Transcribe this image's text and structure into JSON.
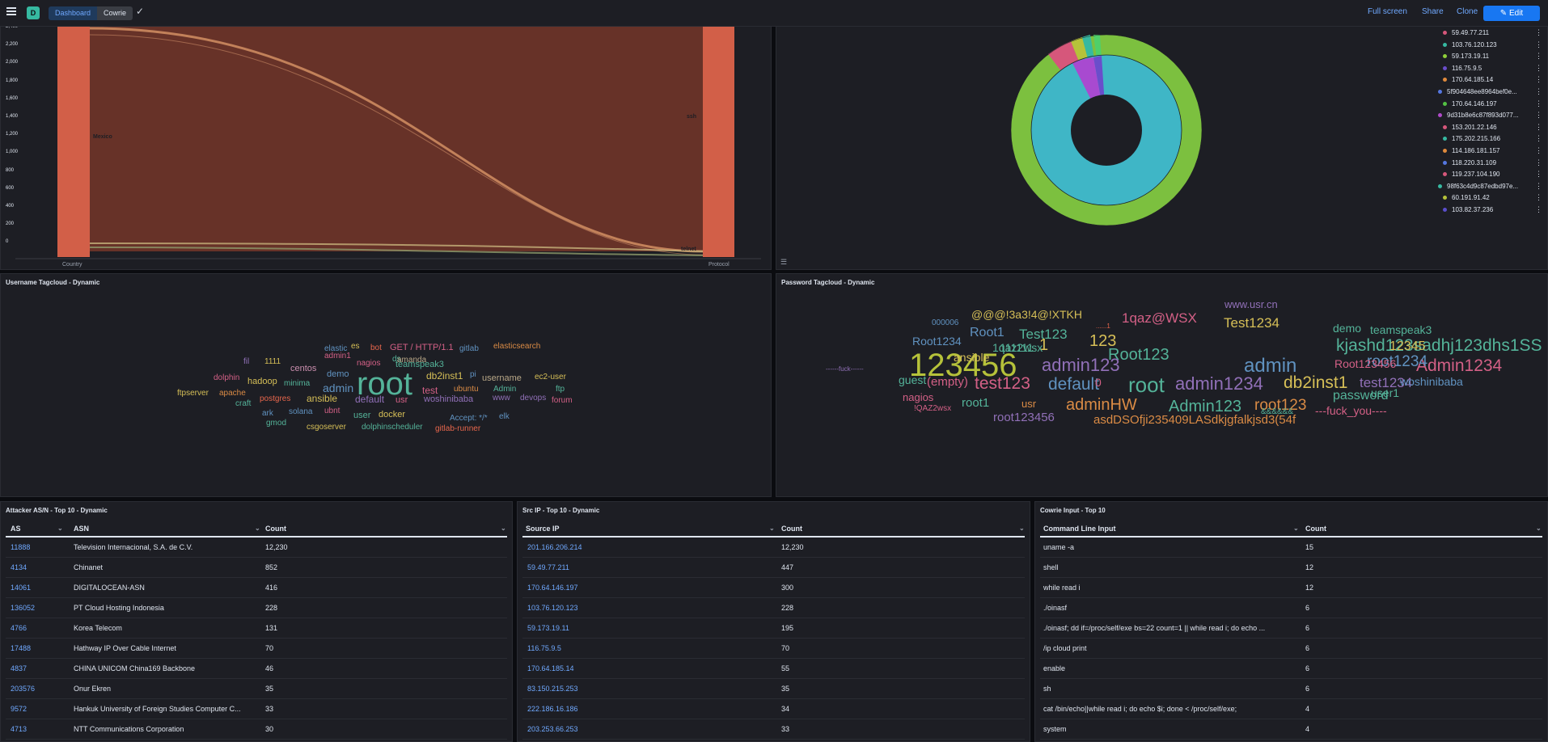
{
  "topbar": {
    "logo_letter": "D",
    "breadcrumb_dashboard": "Dashboard",
    "breadcrumb_current": "Cowrie",
    "check": "✓",
    "full_screen": "Full screen",
    "share": "Share",
    "clone": "Clone",
    "edit": "Edit"
  },
  "sankey": {
    "yticks": [
      "2,400",
      "2,200",
      "2,000",
      "1,800",
      "1,600",
      "1,400",
      "1,200",
      "1,000",
      "800",
      "600",
      "400",
      "200",
      "0"
    ],
    "left_node": "Mexico",
    "right_node_top": "ssh",
    "right_node_bottom": "telnet",
    "xlabel_left": "Country",
    "xlabel_right": "Protocol"
  },
  "donut": {
    "legend": [
      {
        "label": "59.49.77.211",
        "color": "#d6577b"
      },
      {
        "label": "103.76.120.123",
        "color": "#36b9a1"
      },
      {
        "label": "59.173.19.11",
        "color": "#8fcf3a"
      },
      {
        "label": "116.75.9.5",
        "color": "#6a4ecb"
      },
      {
        "label": "170.64.185.14",
        "color": "#e08a3c"
      },
      {
        "label": "5f904648ee8964bef0e...",
        "color": "#5577e0"
      },
      {
        "label": "170.64.146.197",
        "color": "#54c244"
      },
      {
        "label": "9d31b8e6c87f893d077...",
        "color": "#b04ac9"
      },
      {
        "label": "153.201.22.146",
        "color": "#d6577b"
      },
      {
        "label": "175.202.215.166",
        "color": "#36b9a1"
      },
      {
        "label": "114.186.181.157",
        "color": "#e08a3c"
      },
      {
        "label": "118.220.31.109",
        "color": "#5577e0"
      },
      {
        "label": "119.237.104.190",
        "color": "#d6577b"
      },
      {
        "label": "98f63c4d9c87edbd97e...",
        "color": "#36b9a1"
      },
      {
        "label": "60.191.91.42",
        "color": "#b6c23a"
      },
      {
        "label": "103.82.37.236",
        "color": "#5a4ecb"
      }
    ]
  },
  "username_cloud": {
    "title": "Username Tagcloud - Dynamic",
    "words": [
      {
        "t": "root",
        "s": 40,
        "c": "#54b399"
      },
      {
        "t": "GET / HTTP/1.1",
        "s": 11,
        "c": "#d36086"
      },
      {
        "t": "gitlab",
        "s": 10,
        "c": "#6092c0"
      },
      {
        "t": "elasticsearch",
        "s": 10,
        "c": "#da8b45"
      },
      {
        "t": "es",
        "s": 10,
        "c": "#d6bf57"
      },
      {
        "t": "bot",
        "s": 10,
        "c": "#e7664c"
      },
      {
        "t": "elastic",
        "s": 10,
        "c": "#6092c0"
      },
      {
        "t": "admin1",
        "s": 10,
        "c": "#d36086"
      },
      {
        "t": "ds",
        "s": 10,
        "c": "#54b399"
      },
      {
        "t": "nagios",
        "s": 10,
        "c": "#d36086"
      },
      {
        "t": "teamspeak3",
        "s": 11,
        "c": "#54b399"
      },
      {
        "t": "amanda",
        "s": 10,
        "c": "#b9a888"
      },
      {
        "t": "fil",
        "s": 10,
        "c": "#9170b8"
      },
      {
        "t": "1111",
        "s": 10,
        "c": "#d6bf57"
      },
      {
        "t": "centos",
        "s": 11,
        "c": "#ca8eae"
      },
      {
        "t": "demo",
        "s": 11,
        "c": "#6092c0"
      },
      {
        "t": "db2inst1",
        "s": 12,
        "c": "#d6bf57"
      },
      {
        "t": "pi",
        "s": 10,
        "c": "#6092c0"
      },
      {
        "t": "username",
        "s": 11,
        "c": "#b9a888"
      },
      {
        "t": "ec2-user",
        "s": 10,
        "c": "#d6bf57"
      },
      {
        "t": "dolphin",
        "s": 10,
        "c": "#d36086"
      },
      {
        "t": "hadoop",
        "s": 11,
        "c": "#d6bf57"
      },
      {
        "t": "minima",
        "s": 10,
        "c": "#54b399"
      },
      {
        "t": "admin",
        "s": 14,
        "c": "#6092c0"
      },
      {
        "t": "test",
        "s": 12,
        "c": "#d36086"
      },
      {
        "t": "ubuntu",
        "s": 10,
        "c": "#da8b45"
      },
      {
        "t": "Admin",
        "s": 10,
        "c": "#54b399"
      },
      {
        "t": "ftp",
        "s": 10,
        "c": "#54b399"
      },
      {
        "t": "ftpserver",
        "s": 10,
        "c": "#d6bf57"
      },
      {
        "t": "apache",
        "s": 10,
        "c": "#da8b45"
      },
      {
        "t": "craft",
        "s": 10,
        "c": "#54b399"
      },
      {
        "t": "postgres",
        "s": 10,
        "c": "#e7664c"
      },
      {
        "t": "ansible",
        "s": 12,
        "c": "#d6bf57"
      },
      {
        "t": "default",
        "s": 12,
        "c": "#9170b8"
      },
      {
        "t": "usr",
        "s": 11,
        "c": "#d36086"
      },
      {
        "t": "woshinibaba",
        "s": 11,
        "c": "#9170b8"
      },
      {
        "t": "www",
        "s": 10,
        "c": "#9170b8"
      },
      {
        "t": "devops",
        "s": 10,
        "c": "#9170b8"
      },
      {
        "t": "forum",
        "s": 10,
        "c": "#d36086"
      },
      {
        "t": "ark",
        "s": 10,
        "c": "#6092c0"
      },
      {
        "t": "solana",
        "s": 10,
        "c": "#6092c0"
      },
      {
        "t": "ubnt",
        "s": 10,
        "c": "#d36086"
      },
      {
        "t": "user",
        "s": 11,
        "c": "#54b399"
      },
      {
        "t": "docker",
        "s": 11,
        "c": "#d6bf57"
      },
      {
        "t": "Accept: */*",
        "s": 10,
        "c": "#6092c0"
      },
      {
        "t": "elk",
        "s": 10,
        "c": "#6092c0"
      },
      {
        "t": "gmod",
        "s": 10,
        "c": "#54b399"
      },
      {
        "t": "csgoserver",
        "s": 10,
        "c": "#d6bf57"
      },
      {
        "t": "dolphinscheduler",
        "s": 10,
        "c": "#54b399"
      },
      {
        "t": "gitlab-runner",
        "s": 10,
        "c": "#e7664c"
      }
    ]
  },
  "password_cloud": {
    "title": "Password Tagcloud - Dynamic",
    "words": [
      {
        "t": "www.usr.cn",
        "s": 13,
        "c": "#9170b8"
      },
      {
        "t": "@@@!3a3!4@!XTKH",
        "s": 14,
        "c": "#d6bf57"
      },
      {
        "t": "1qaz@WSX",
        "s": 17,
        "c": "#d36086"
      },
      {
        "t": "Test1234",
        "s": 17,
        "c": "#d6bf57"
      },
      {
        "t": "000006",
        "s": 10,
        "c": "#6092c0"
      },
      {
        "t": "......1",
        "s": 8,
        "c": "#e7664c"
      },
      {
        "t": "demo",
        "s": 14,
        "c": "#54b399"
      },
      {
        "t": "teamspeak3",
        "s": 14,
        "c": "#54b399"
      },
      {
        "t": "Root1",
        "s": 16,
        "c": "#6092c0"
      },
      {
        "t": "Test123",
        "s": 17,
        "c": "#54b399"
      },
      {
        "t": "Root1234",
        "s": 14,
        "c": "#6092c0"
      },
      {
        "t": "1",
        "s": 20,
        "c": "#d6bf57"
      },
      {
        "t": "123",
        "s": 20,
        "c": "#d6bf57"
      },
      {
        "t": "kjashd123sadhj123dhs1SS",
        "s": 21,
        "c": "#54b399"
      },
      {
        "t": "12345",
        "s": 16,
        "c": "#d6bf57"
      },
      {
        "t": "1qaz2wsx",
        "s": 14,
        "c": "#54b399"
      },
      {
        "t": "111111",
        "s": 14,
        "c": "#54b399"
      },
      {
        "t": "Root123",
        "s": 20,
        "c": "#54b399"
      },
      {
        "t": "123456",
        "s": 40,
        "c": "#b6c23a"
      },
      {
        "t": "ansible",
        "s": 14,
        "c": "#d6bf57"
      },
      {
        "t": "admin123",
        "s": 22,
        "c": "#9170b8"
      },
      {
        "t": "admin",
        "s": 24,
        "c": "#6092c0"
      },
      {
        "t": "Admin1234",
        "s": 21,
        "c": "#d36086"
      },
      {
        "t": "root1234",
        "s": 19,
        "c": "#6092c0"
      },
      {
        "t": "Root123456",
        "s": 14,
        "c": "#d36086"
      },
      {
        "t": "------fuck------",
        "s": 8,
        "c": "#9170b8"
      },
      {
        "t": "guest",
        "s": 14,
        "c": "#54b399"
      },
      {
        "t": "(empty)",
        "s": 15,
        "c": "#d36086"
      },
      {
        "t": "test123",
        "s": 21,
        "c": "#d36086"
      },
      {
        "t": "default",
        "s": 21,
        "c": "#6092c0"
      },
      {
        "t": "0",
        "s": 14,
        "c": "#d36086"
      },
      {
        "t": "root",
        "s": 26,
        "c": "#54b399"
      },
      {
        "t": "admin1234",
        "s": 22,
        "c": "#9170b8"
      },
      {
        "t": "db2inst1",
        "s": 21,
        "c": "#d6bf57"
      },
      {
        "t": "test1234",
        "s": 17,
        "c": "#9170b8"
      },
      {
        "t": "woshinibaba",
        "s": 14,
        "c": "#6092c0"
      },
      {
        "t": "nagios",
        "s": 13,
        "c": "#d36086"
      },
      {
        "t": "password",
        "s": 16,
        "c": "#54b399"
      },
      {
        "t": "user1",
        "s": 14,
        "c": "#54b399"
      },
      {
        "t": "root1",
        "s": 15,
        "c": "#54b399"
      },
      {
        "t": "usr",
        "s": 13,
        "c": "#da8b45"
      },
      {
        "t": "adminHW",
        "s": 20,
        "c": "#da8b45"
      },
      {
        "t": "Admin123",
        "s": 20,
        "c": "#54b399"
      },
      {
        "t": "root123",
        "s": 19,
        "c": "#da8b45"
      },
      {
        "t": "!QAZ2wsx",
        "s": 10,
        "c": "#d36086"
      },
      {
        "t": "&&&&&&",
        "s": 10,
        "c": "#54b399"
      },
      {
        "t": "---fuck_you----",
        "s": 14,
        "c": "#d36086"
      },
      {
        "t": "root123456",
        "s": 15,
        "c": "#9170b8"
      },
      {
        "t": "asdDSOfji235409LASdkjgfalkjsd3(54f",
        "s": 15,
        "c": "#da8b45"
      }
    ]
  },
  "asn_table": {
    "title": "Attacker AS/N - Top 10 - Dynamic",
    "headers": [
      "AS",
      "ASN",
      "Count"
    ],
    "rows": [
      [
        "11888",
        "Television Internacional, S.A. de C.V.",
        "12,230"
      ],
      [
        "4134",
        "Chinanet",
        "852"
      ],
      [
        "14061",
        "DIGITALOCEAN-ASN",
        "416"
      ],
      [
        "136052",
        "PT Cloud Hosting Indonesia",
        "228"
      ],
      [
        "4766",
        "Korea Telecom",
        "131"
      ],
      [
        "17488",
        "Hathway IP Over Cable Internet",
        "70"
      ],
      [
        "4837",
        "CHINA UNICOM China169 Backbone",
        "46"
      ],
      [
        "203576",
        "Onur Ekren",
        "35"
      ],
      [
        "9572",
        "Hankuk University of Foreign Studies Computer C...",
        "33"
      ],
      [
        "4713",
        "NTT Communications Corporation",
        "30"
      ]
    ]
  },
  "srcip_table": {
    "title": "Src IP - Top 10 - Dynamic",
    "headers": [
      "Source IP",
      "Count"
    ],
    "rows": [
      [
        "201.166.206.214",
        "12,230"
      ],
      [
        "59.49.77.211",
        "447"
      ],
      [
        "170.64.146.197",
        "300"
      ],
      [
        "103.76.120.123",
        "228"
      ],
      [
        "59.173.19.11",
        "195"
      ],
      [
        "116.75.9.5",
        "70"
      ],
      [
        "170.64.185.14",
        "55"
      ],
      [
        "83.150.215.253",
        "35"
      ],
      [
        "222.186.16.186",
        "34"
      ],
      [
        "203.253.66.253",
        "33"
      ]
    ]
  },
  "input_table": {
    "title": "Cowrie Input - Top 10",
    "headers": [
      "Command Line Input",
      "Count"
    ],
    "rows": [
      [
        "uname -a",
        "15"
      ],
      [
        "shell",
        "12"
      ],
      [
        "while read i",
        "12"
      ],
      [
        "./oinasf",
        "6"
      ],
      [
        "./oinasf; dd if=/proc/self/exe bs=22 count=1 || while read i; do echo ...",
        "6"
      ],
      [
        "/ip cloud print",
        "6"
      ],
      [
        "enable",
        "6"
      ],
      [
        "sh",
        "6"
      ],
      [
        "cat /bin/echo||while read i; do echo $i; done < /proc/self/exe;",
        "4"
      ],
      [
        "system",
        "4"
      ]
    ]
  }
}
